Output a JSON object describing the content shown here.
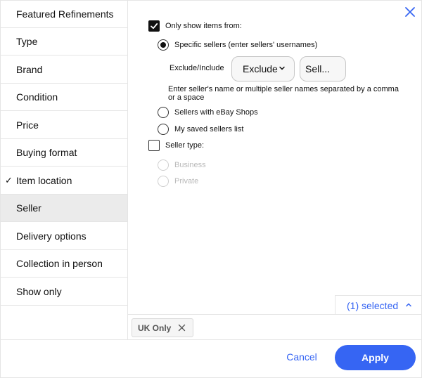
{
  "sidebar": {
    "items": [
      {
        "label": "Featured Refinements",
        "checked": false,
        "active": false
      },
      {
        "label": "Type",
        "checked": false,
        "active": false
      },
      {
        "label": "Brand",
        "checked": false,
        "active": false
      },
      {
        "label": "Condition",
        "checked": false,
        "active": false
      },
      {
        "label": "Price",
        "checked": false,
        "active": false
      },
      {
        "label": "Buying format",
        "checked": false,
        "active": false
      },
      {
        "label": "Item location",
        "checked": true,
        "active": false
      },
      {
        "label": "Seller",
        "checked": false,
        "active": true
      },
      {
        "label": "Delivery options",
        "checked": false,
        "active": false
      },
      {
        "label": "Collection in person",
        "checked": false,
        "active": false
      },
      {
        "label": "Show only",
        "checked": false,
        "active": false
      }
    ],
    "check_glyph": "✓"
  },
  "panel": {
    "only_show_label": "Only show items from:",
    "only_show_checked": true,
    "specific_sellers_label": "Specific sellers (enter sellers' usernames)",
    "specific_sellers_selected": true,
    "exclude_include_label": "Exclude/Include",
    "exclude_value": "Exclude",
    "sellers_input_value": "Sell...",
    "helper_text": "Enter seller's name or multiple seller names separated by a comma or a space",
    "ebay_shops_label": "Sellers with eBay Shops",
    "saved_sellers_label": "My saved sellers list",
    "seller_type_label": "Seller type:",
    "seller_type_checked": false,
    "business_label": "Business",
    "private_label": "Private"
  },
  "selected": {
    "label": "(1) selected",
    "chips": [
      "UK Only"
    ]
  },
  "footer": {
    "cancel_label": "Cancel",
    "apply_label": "Apply"
  },
  "colors": {
    "accent": "#3665f3",
    "active_bg": "#ebebeb",
    "disabled_text": "#b9b9b9"
  }
}
